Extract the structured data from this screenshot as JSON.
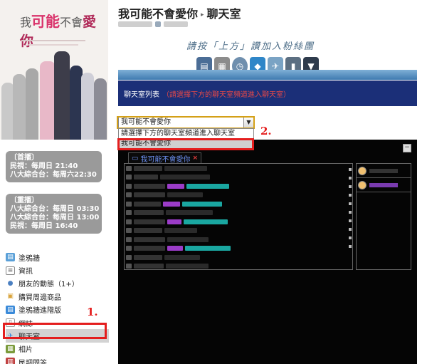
{
  "left": {
    "poster": {
      "title_pre": "我",
      "title_hl": "可能",
      "title_mid": "不會",
      "title_hl2": "愛你"
    },
    "first_run": {
      "label": "〔首播〕",
      "lines": [
        "民視：每周日 21:40",
        "八大綜合台：每周六22:30"
      ]
    },
    "rerun": {
      "label": "〔重播〕",
      "lines": [
        "八大綜合台：每周日 03:30",
        "八大綜合台：每周日 13:00",
        "民視：每周日 16:40"
      ]
    },
    "menu": [
      {
        "label": "塗鴉牆",
        "icon": "wall-icon",
        "color": "#5aa0d8"
      },
      {
        "label": "資訊",
        "icon": "info-icon",
        "color": "#888888"
      },
      {
        "label": "朋友的動態（1+）",
        "icon": "friends-icon",
        "color": "#4a7fc1"
      },
      {
        "label": "購買周邊商品",
        "icon": "shop-icon",
        "color": "#d9a33a"
      },
      {
        "label": "塗鴉牆進階版",
        "icon": "wall-advanced-icon",
        "color": "#3a8ad9"
      },
      {
        "label": "網誌",
        "icon": "blog-icon",
        "color": "#999999"
      },
      {
        "label": "聊天室",
        "icon": "chat-icon",
        "color": "#3a8ad9"
      },
      {
        "label": "相片",
        "icon": "photo-icon",
        "color": "#7a9a3a"
      },
      {
        "label": "民調問答",
        "icon": "poll-icon",
        "color": "#c04040"
      }
    ],
    "step1": "1."
  },
  "main": {
    "title": "我可能不會愛你",
    "crumb_sep": "▸",
    "section": "聊天室",
    "banner": {
      "slogan": "請按「上方」讚加入粉絲團"
    },
    "list_bar": {
      "label": "聊天室列表",
      "hint": "（請選擇下方的聊天室頻道進入聊天室）"
    },
    "select": {
      "value": "我可能不會愛你",
      "arrow": "▼"
    },
    "dropdown": {
      "options": [
        "請選擇下方的聊天室頻道進入聊天室",
        "我可能不會愛你"
      ],
      "selected_index": 1
    },
    "step2": "2.",
    "chat": {
      "tab_label": "我可能不會愛你",
      "tab_close": "×",
      "minimize": "−"
    }
  },
  "colors": {
    "accent_red": "#e41e1e",
    "bar_blue": "#1b2f78",
    "chat_bg": "#050505",
    "tab_text": "#6c8ff0"
  }
}
